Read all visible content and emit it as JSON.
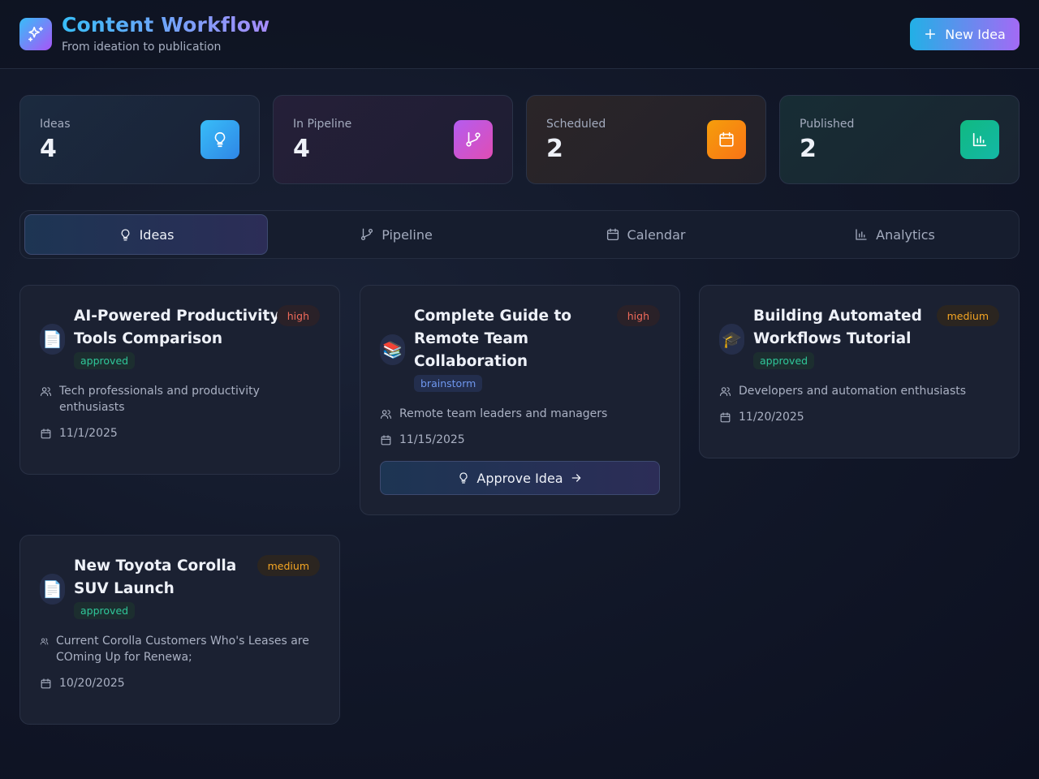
{
  "header": {
    "title": "Content Workflow",
    "subtitle": "From ideation to publication",
    "new_idea_label": "New Idea"
  },
  "stats": [
    {
      "label": "Ideas",
      "value": "4",
      "icon": "lightbulb-icon"
    },
    {
      "label": "In Pipeline",
      "value": "4",
      "icon": "git-branch-icon"
    },
    {
      "label": "Scheduled",
      "value": "2",
      "icon": "calendar-icon"
    },
    {
      "label": "Published",
      "value": "2",
      "icon": "bar-chart-icon"
    }
  ],
  "tabs": [
    {
      "label": "Ideas",
      "icon": "lightbulb-icon",
      "active": true
    },
    {
      "label": "Pipeline",
      "icon": "git-branch-icon",
      "active": false
    },
    {
      "label": "Calendar",
      "icon": "calendar-icon",
      "active": false
    },
    {
      "label": "Analytics",
      "icon": "bar-chart-icon",
      "active": false
    }
  ],
  "ideas": [
    {
      "emoji": "📄",
      "title_lines": [
        "AI-Powered Productivity",
        "Tools Comparison"
      ],
      "priority": "high",
      "status": "approved",
      "audience_lines": [
        "Tech professionals and productivity",
        "enthusiasts"
      ],
      "date": "11/1/2025"
    },
    {
      "emoji": "📚",
      "title_lines": [
        "Complete Guide to",
        "Remote Team",
        "Collaboration"
      ],
      "priority": "high",
      "status": "brainstorm",
      "audience_lines": [
        "Remote team leaders and managers"
      ],
      "date": "11/15/2025",
      "action_label": "Approve Idea"
    },
    {
      "emoji": "🎓",
      "title_lines": [
        "Building Automated",
        "Workflows Tutorial"
      ],
      "priority": "medium",
      "status": "approved",
      "audience_lines": [
        "Developers and automation enthusiasts"
      ],
      "date": "11/20/2025"
    },
    {
      "emoji": "📄",
      "title_lines": [
        "New Toyota Corolla",
        "SUV Launch"
      ],
      "priority": "medium",
      "status": "approved",
      "audience_lines": [
        "Current Corolla Customers Who's Leases are",
        "COming Up for Renewa;"
      ],
      "date": "10/20/2025"
    }
  ],
  "colors": {
    "accent_blue": "#38bdf8",
    "accent_purple": "#a855f7",
    "priority_high": "#ef6a5a",
    "priority_medium": "#f5a623",
    "status_approved": "#2fc89a",
    "status_brainstorm": "#6f97ee"
  }
}
